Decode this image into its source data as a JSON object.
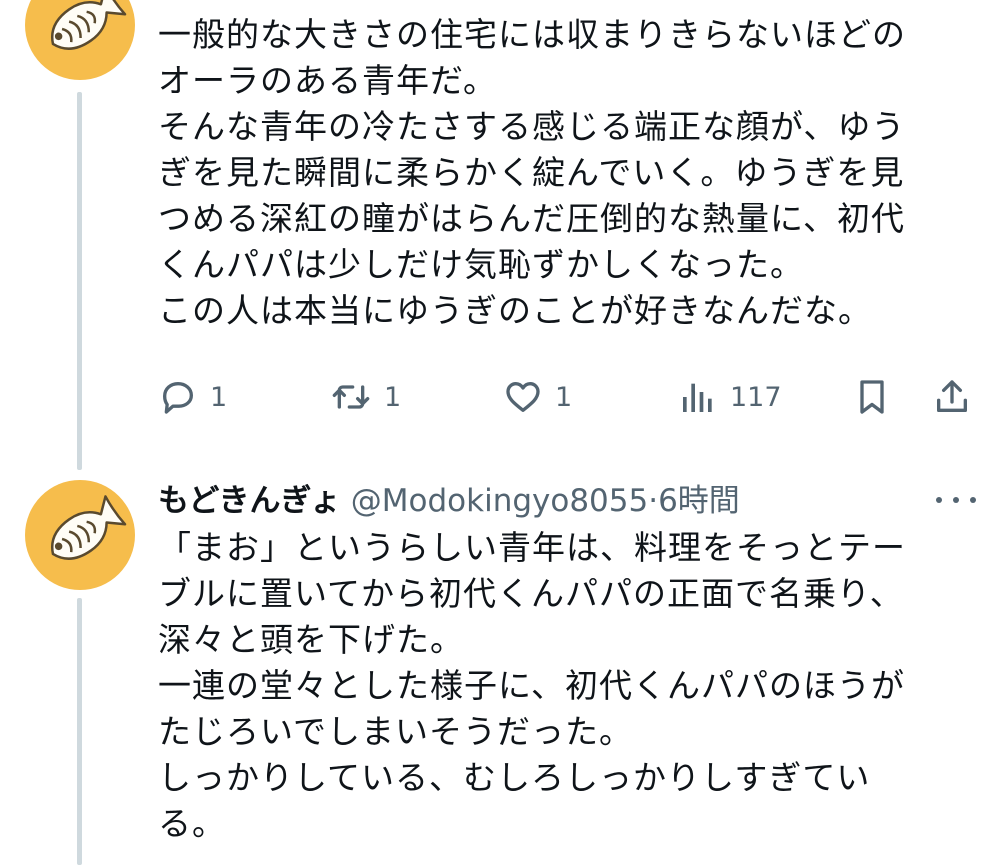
{
  "tweets": [
    {
      "lines": [
        "一般的な大きさの住宅には収まりきらないほどの",
        "オーラのある青年だ。",
        "そんな青年の冷たさする感じる端正な顔が、ゆう",
        "ぎを見た瞬間に柔らかく綻んでいく。ゆうぎを見",
        "つめる深紅の瞳がはらんだ圧倒的な熱量に、初代",
        "くんパパは少しだけ気恥ずかしくなった。",
        "この人は本当にゆうぎのことが好きなんだな。"
      ],
      "actions": {
        "reply_count": "1",
        "retweet_count": "1",
        "like_count": "1",
        "view_count": "117"
      }
    },
    {
      "display_name": "もどきんぎょ",
      "handle": "@Modokingyo8055",
      "separator": "·",
      "time": "6時間",
      "lines": [
        "「まお」というらしい青年は、料理をそっとテー",
        "ブルに置いてから初代くんパパの正面で名乗り、",
        "深々と頭を下げた。",
        "一連の堂々とした様子に、初代くんパパのほうが",
        "たじろいでしまいそうだった。",
        "しっかりしている、むしろしっかりしすぎてい",
        "る。"
      ]
    }
  ],
  "icons": {
    "avatar": "taiyaki-fish-icon",
    "reply": "reply-icon",
    "retweet": "retweet-icon",
    "like": "heart-icon",
    "views": "bar-chart-icon",
    "bookmark": "bookmark-icon",
    "share": "share-icon",
    "more": "more-icon"
  },
  "colors": {
    "text": "#0f1419",
    "secondary": "#536471",
    "thread_line": "#cfd9de",
    "avatar_bg": "#f6bd4c"
  }
}
